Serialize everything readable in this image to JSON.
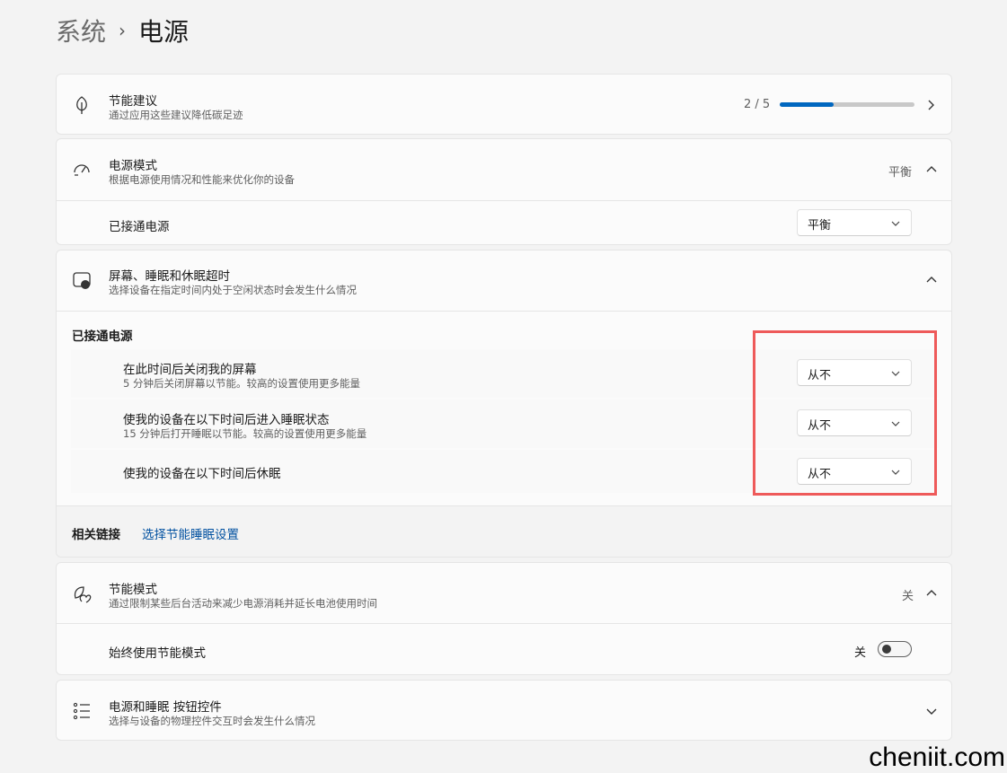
{
  "breadcrumb": {
    "parent": "系统",
    "separator": "›",
    "current": "电源"
  },
  "energy_tips": {
    "title": "节能建议",
    "subtitle": "通过应用这些建议降低碳足迹",
    "progress_text": "2 / 5",
    "progress_fraction": 0.4
  },
  "power_mode": {
    "title": "电源模式",
    "subtitle": "根据电源使用情况和性能来优化你的设备",
    "current_value": "平衡",
    "plugged_label": "已接通电源",
    "plugged_value": "平衡"
  },
  "screen_sleep": {
    "title": "屏幕、睡眠和休眠超时",
    "subtitle": "选择设备在指定时间内处于空闲状态时会发生什么情况",
    "section_label": "已接通电源",
    "rows": [
      {
        "title": "在此时间后关闭我的屏幕",
        "subtitle": "5 分钟后关闭屏幕以节能。较高的设置使用更多能量",
        "value": "从不"
      },
      {
        "title": "使我的设备在以下时间后进入睡眠状态",
        "subtitle": "15 分钟后打开睡眠以节能。较高的设置使用更多能量",
        "value": "从不"
      },
      {
        "title": "使我的设备在以下时间后休眠",
        "subtitle": "",
        "value": "从不"
      }
    ],
    "related_label": "相关链接",
    "related_link": "选择节能睡眠设置"
  },
  "battery_saver": {
    "title": "节能模式",
    "subtitle": "通过限制某些后台活动来减少电源消耗并延长电池使用时间",
    "state": "关",
    "always_label": "始终使用节能模式",
    "always_state": "关"
  },
  "buttons": {
    "title": "电源和睡眠 按钮控件",
    "subtitle": "选择与设备的物理控件交互时会发生什么情况"
  },
  "watermark": "cheniit.com",
  "colors": {
    "accent": "#0067c0",
    "highlight": "#ee5a5a",
    "link": "#0050a0"
  }
}
